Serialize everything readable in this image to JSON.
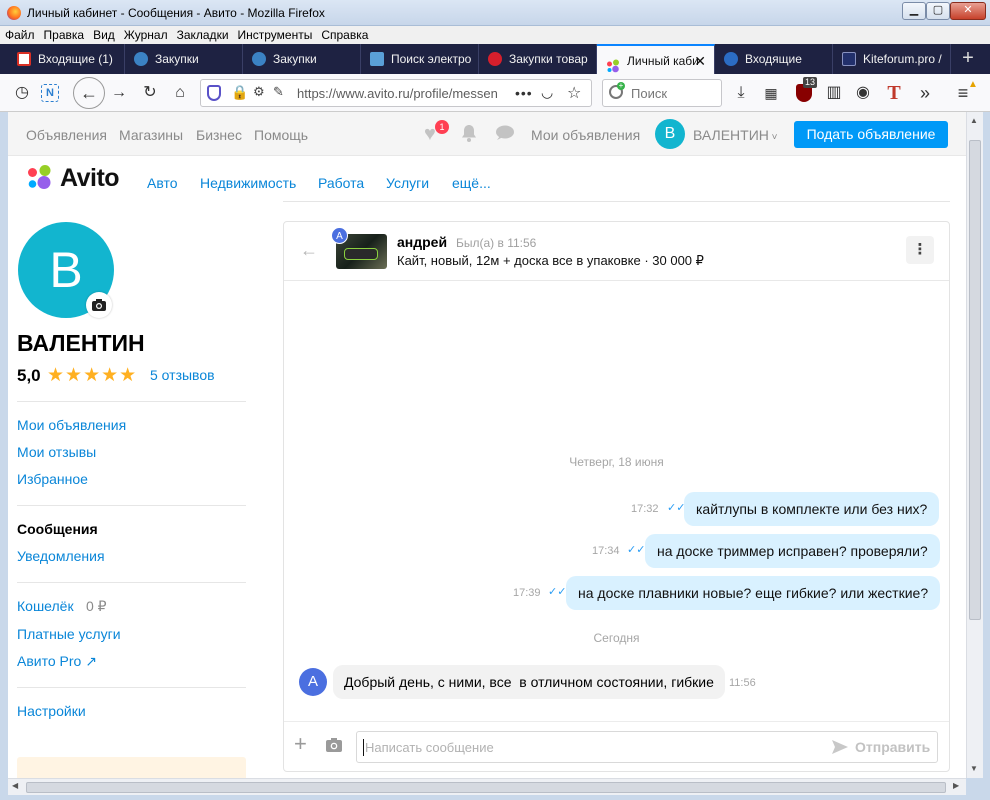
{
  "window": {
    "title": "Личный кабинет - Сообщения - Авито - Mozilla Firefox"
  },
  "menu": [
    "Файл",
    "Правка",
    "Вид",
    "Журнал",
    "Закладки",
    "Инструменты",
    "Справка"
  ],
  "tabs": [
    {
      "label": "Входящие (1)",
      "color": "#d93025"
    },
    {
      "label": "Закупки",
      "color": "#3b82c4"
    },
    {
      "label": "Закупки",
      "color": "#3b82c4"
    },
    {
      "label": "Поиск электро",
      "color": "#5aa0d8"
    },
    {
      "label": "Закупки товар",
      "color": "#d61f2c"
    },
    {
      "label": "Личный каби",
      "color": "#97cf26"
    },
    {
      "label": "Входящие",
      "color": "#2b6cc4"
    },
    {
      "label": "Kiteforum.pro /",
      "color": "#22306b"
    }
  ],
  "toolbar": {
    "url": "https://www.avito.ru/profile/messen",
    "search_placeholder": "Поиск",
    "ublock_count": "13"
  },
  "avito": {
    "top_links": [
      "Объявления",
      "Магазины",
      "Бизнес",
      "Помощь"
    ],
    "fav_count": "1",
    "my_ads": "Мои объявления",
    "user_initial": "В",
    "user_name": "ВАЛЕНТИН",
    "post_button": "Подать объявление",
    "logo": "Avito",
    "categories": [
      "Авто",
      "Недвижимость",
      "Работа",
      "Услуги",
      "ещё..."
    ]
  },
  "profile": {
    "initial": "В",
    "name": "ВАЛЕНТИН",
    "rating": "5,0",
    "stars": 5,
    "reviews": "5 отзывов",
    "links_group1": [
      "Мои объявления",
      "Мои отзывы",
      "Избранное"
    ],
    "messages": "Сообщения",
    "notifications": "Уведомления",
    "wallet": "Кошелёк",
    "wallet_amount": "0 ₽",
    "paid": "Платные услуги",
    "pro": "Авито Pro ↗",
    "settings": "Настройки"
  },
  "chat": {
    "contact_initial": "А",
    "contact_name": "андрей",
    "last_seen": "Был(а) в 11:56",
    "item": "Кайт, новый, 12м + доска все в упаковке · 30 000 ₽",
    "date1": "Четверг, 18 июня",
    "messages_out": [
      {
        "time": "17:32",
        "text": "кайтлупы в комплекте или без них?"
      },
      {
        "time": "17:34",
        "text": "на доске триммер исправен? проверяли?"
      },
      {
        "time": "17:39",
        "text": "на доске плавники новые? еще гибкие? или жесткие?"
      }
    ],
    "date2": "Сегодня",
    "message_in": {
      "initial": "А",
      "text": "Добрый день, с ними, все  в отличном состоянии, гибкие",
      "time": "11:56"
    },
    "input_placeholder": "Написать сообщение",
    "send": "Отправить"
  }
}
